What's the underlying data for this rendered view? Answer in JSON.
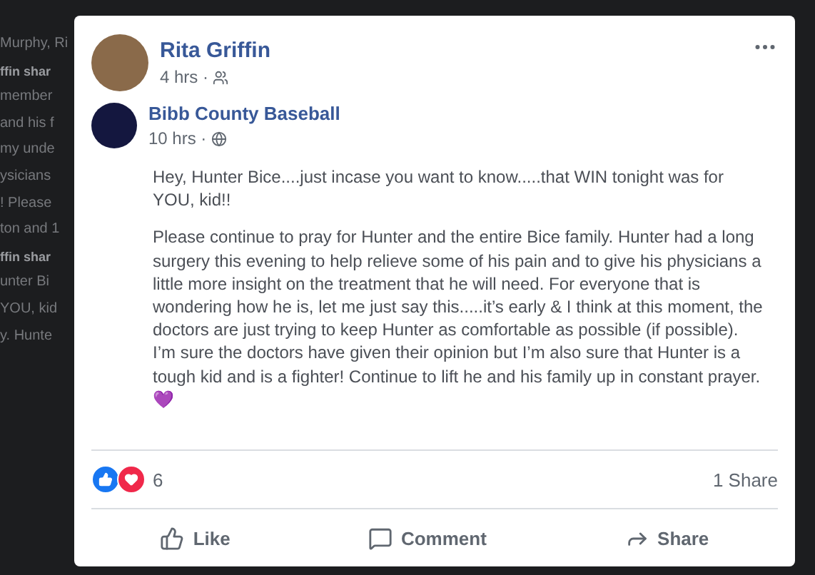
{
  "background_fragments": [
    {
      "text": "Murphy, Ri",
      "bold": false
    },
    {
      "text": "ffin shar",
      "bold": true
    },
    {
      "text": "member",
      "bold": false
    },
    {
      "text": "and his f",
      "bold": false
    },
    {
      "text": "my unde",
      "bold": false
    },
    {
      "text": "ysicians",
      "bold": false
    },
    {
      "text": "! Please",
      "bold": false
    },
    {
      "text": "ton and 1",
      "bold": false
    },
    {
      "text": "ffin shar",
      "bold": true
    },
    {
      "text": "unter Bi",
      "bold": false
    },
    {
      "text": "YOU, kid",
      "bold": false
    },
    {
      "text": "y. Hunte",
      "bold": false
    }
  ],
  "post": {
    "author": "Rita Griffin",
    "time": "4 hrs ·",
    "audience": {
      "kind": "friends"
    },
    "shared": {
      "author": "Bibb County Baseball",
      "time": "10 hrs ·",
      "audience": {
        "kind": "public"
      },
      "paragraphs": [
        "Hey, Hunter Bice....just incase you want to know.....that WIN tonight was for YOU, kid!!",
        "Please continue to pray for Hunter and the entire Bice family. Hunter had a long surgery this evening to help relieve some of his pain and to give his physicians a little more insight on the treatment that he will need. For everyone that is wondering how he is, let me just say this.....it’s early & I think at this moment, the doctors are just trying to keep Hunter as comfortable as possible (if possible). I’m sure the doctors have given their opinion but I’m also sure that Hunter is a tough kid and is a fighter! Continue to lift he and his family up in constant prayer. 💜"
      ]
    },
    "reactions": {
      "icons": [
        {
          "kind": "like"
        },
        {
          "kind": "love"
        }
      ],
      "count": "6"
    },
    "shares": "1 Share",
    "actions": [
      {
        "kind": "like",
        "label": "Like"
      },
      {
        "kind": "comment",
        "label": "Comment"
      },
      {
        "kind": "share",
        "label": "Share"
      }
    ]
  }
}
